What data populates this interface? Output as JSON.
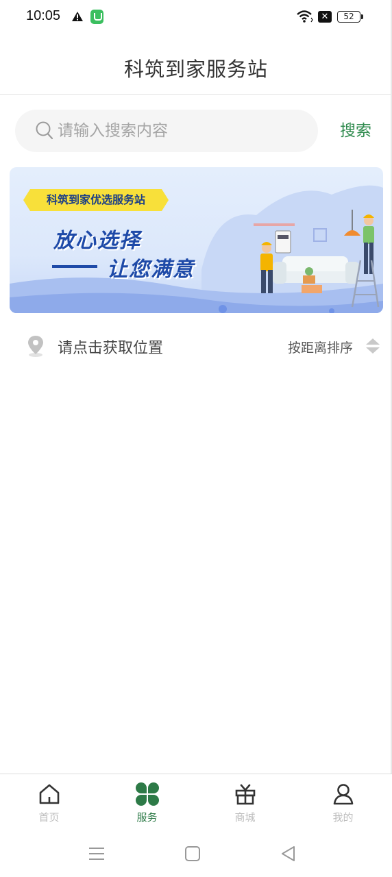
{
  "status_bar": {
    "time": "10:05",
    "battery": "52",
    "icons": [
      "warning-icon",
      "app-notification-icon",
      "wifi-icon",
      "close-box-icon",
      "battery-icon"
    ]
  },
  "header": {
    "title": "科筑到家服务站"
  },
  "search": {
    "placeholder": "请输入搜索内容",
    "value": "",
    "button_label": "搜索"
  },
  "banner": {
    "tag": "科筑到家优选服务站",
    "line1": "放心选择",
    "line2": "让您满意"
  },
  "location": {
    "prompt": "请点击获取位置",
    "sort_label": "按距离排序"
  },
  "tab_bar": {
    "items": [
      {
        "label": "首页",
        "icon": "home-icon"
      },
      {
        "label": "服务",
        "icon": "clover-icon",
        "active": true
      },
      {
        "label": "商城",
        "icon": "gift-icon"
      },
      {
        "label": "我的",
        "icon": "user-icon"
      }
    ]
  },
  "system_nav": {
    "buttons": [
      "menu-icon",
      "home-square-icon",
      "back-triangle-icon"
    ]
  },
  "colors": {
    "accent": "#2d7a47",
    "search_button": "#2f8b4e",
    "banner_text": "#1e4aa8",
    "banner_tag_bg": "#f8e03a"
  }
}
